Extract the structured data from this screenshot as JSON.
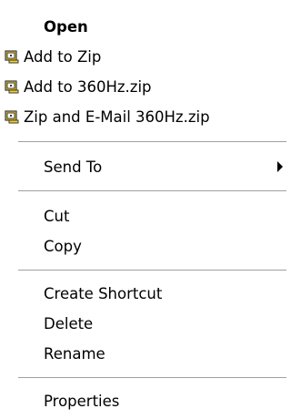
{
  "menu": {
    "open": "Open",
    "add_to_zip": "Add to Zip",
    "add_to_named_zip": "Add to 360Hz.zip",
    "zip_and_email": "Zip and E-Mail 360Hz.zip",
    "send_to": "Send To",
    "cut": "Cut",
    "copy": "Copy",
    "create_shortcut": "Create Shortcut",
    "delete": "Delete",
    "rename": "Rename",
    "properties": "Properties"
  },
  "icons": {
    "winzip": "winzip-icon",
    "submenu": "chevron-right-icon"
  },
  "colors": {
    "background": "#ffffff",
    "text": "#000000",
    "separator": "#a0a0a0",
    "icon_yellow": "#f2d027",
    "icon_dark": "#3a3a3a"
  }
}
